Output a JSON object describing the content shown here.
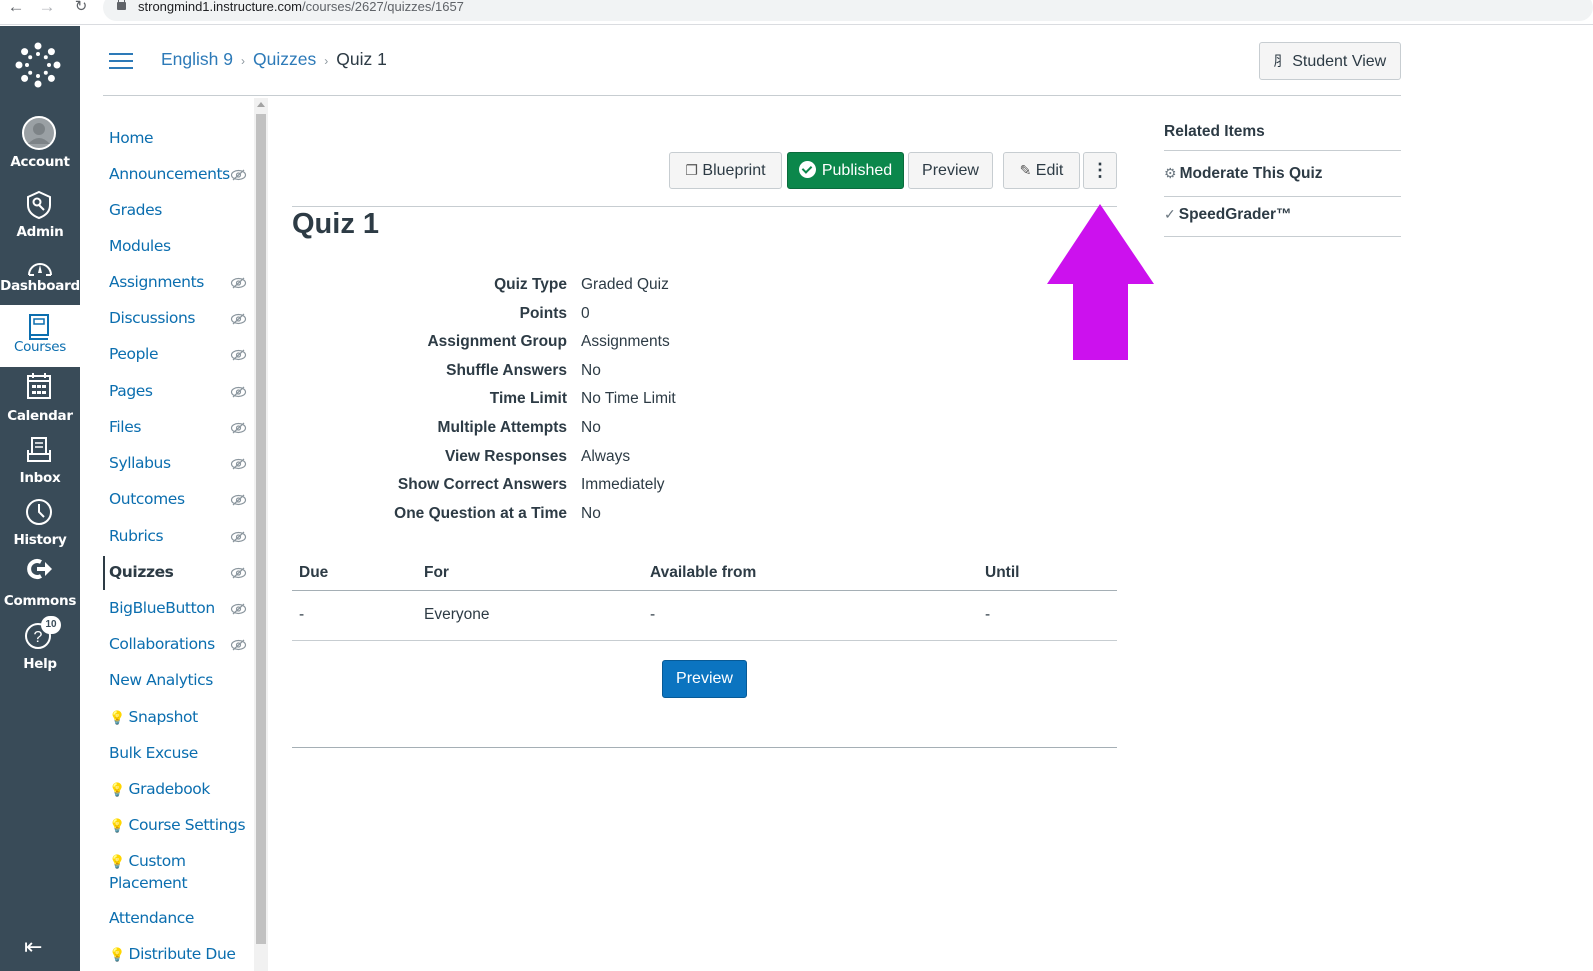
{
  "browser": {
    "url_host": "strongmind1.instructure.com",
    "url_path": "/courses/2627/quizzes/1657",
    "back_glyph": "←",
    "forward_glyph": "→",
    "reload_glyph": "↻"
  },
  "global_nav": {
    "items": [
      {
        "label": "Account",
        "icon": "avatar-icon"
      },
      {
        "label": "Admin",
        "icon": "shield-key-icon"
      },
      {
        "label": "Dashboard",
        "icon": "speedometer-icon"
      },
      {
        "label": "Courses",
        "icon": "book-icon",
        "active": true
      },
      {
        "label": "Calendar",
        "icon": "calendar-icon"
      },
      {
        "label": "Inbox",
        "icon": "inbox-icon"
      },
      {
        "label": "History",
        "icon": "clock-icon"
      },
      {
        "label": "Commons",
        "icon": "commons-arrow-icon"
      },
      {
        "label": "Help",
        "icon": "help-icon",
        "badge": "10"
      }
    ],
    "collapse_glyph": "⇤"
  },
  "header": {
    "breadcrumb": [
      {
        "label": "English 9"
      },
      {
        "label": "Quizzes"
      },
      {
        "label": "Quiz 1"
      }
    ],
    "separator": "›",
    "student_view_label": "Student View"
  },
  "course_nav": {
    "items": [
      {
        "label": "Home",
        "hidden": false
      },
      {
        "label": "Announcements",
        "hidden": true
      },
      {
        "label": "Grades",
        "hidden": false
      },
      {
        "label": "Modules",
        "hidden": false
      },
      {
        "label": "Assignments",
        "hidden": true
      },
      {
        "label": "Discussions",
        "hidden": true
      },
      {
        "label": "People",
        "hidden": true
      },
      {
        "label": "Pages",
        "hidden": true
      },
      {
        "label": "Files",
        "hidden": true
      },
      {
        "label": "Syllabus",
        "hidden": true
      },
      {
        "label": "Outcomes",
        "hidden": true
      },
      {
        "label": "Rubrics",
        "hidden": true
      },
      {
        "label": "Quizzes",
        "hidden": true,
        "active": true
      },
      {
        "label": "BigBlueButton",
        "hidden": true
      },
      {
        "label": "Collaborations",
        "hidden": true
      },
      {
        "label": "New Analytics",
        "hidden": false
      },
      {
        "label": "Snapshot",
        "bulb": true
      },
      {
        "label": "Bulk Excuse"
      },
      {
        "label": "Gradebook",
        "bulb": true
      },
      {
        "label": "Course Settings",
        "bulb": true
      },
      {
        "label": "Custom Placement",
        "bulb": true
      },
      {
        "label": "Attendance"
      },
      {
        "label": "Distribute Due",
        "bulb": true
      }
    ],
    "bulb_glyph": "💡"
  },
  "toolbar": {
    "blueprint_label": "Blueprint",
    "published_label": "Published",
    "preview_label": "Preview",
    "edit_label": "Edit",
    "kebab_glyph": "⋮"
  },
  "quiz": {
    "title": "Quiz 1",
    "details": [
      {
        "label": "Quiz Type",
        "value": "Graded Quiz"
      },
      {
        "label": "Points",
        "value": "0"
      },
      {
        "label": "Assignment Group",
        "value": "Assignments"
      },
      {
        "label": "Shuffle Answers",
        "value": "No"
      },
      {
        "label": "Time Limit",
        "value": "No Time Limit"
      },
      {
        "label": "Multiple Attempts",
        "value": "No"
      },
      {
        "label": "View Responses",
        "value": "Always"
      },
      {
        "label": "Show Correct Answers",
        "value": "Immediately"
      },
      {
        "label": "One Question at a Time",
        "value": "No"
      }
    ],
    "due_table": {
      "headers": [
        "Due",
        "For",
        "Available from",
        "Until"
      ],
      "rows": [
        [
          "-",
          "Everyone",
          "-",
          "-"
        ]
      ]
    },
    "preview_button_label": "Preview"
  },
  "related_items": {
    "title": "Related Items",
    "links": [
      {
        "label": "Moderate This Quiz",
        "icon": "gear-icon",
        "glyph": "⚙"
      },
      {
        "label": "SpeedGrader™",
        "icon": "speedgrader-icon",
        "glyph": "✓"
      }
    ]
  },
  "annotation": {
    "arrow_color": "#cc11ee",
    "points_to": "kebab-menu-button"
  }
}
